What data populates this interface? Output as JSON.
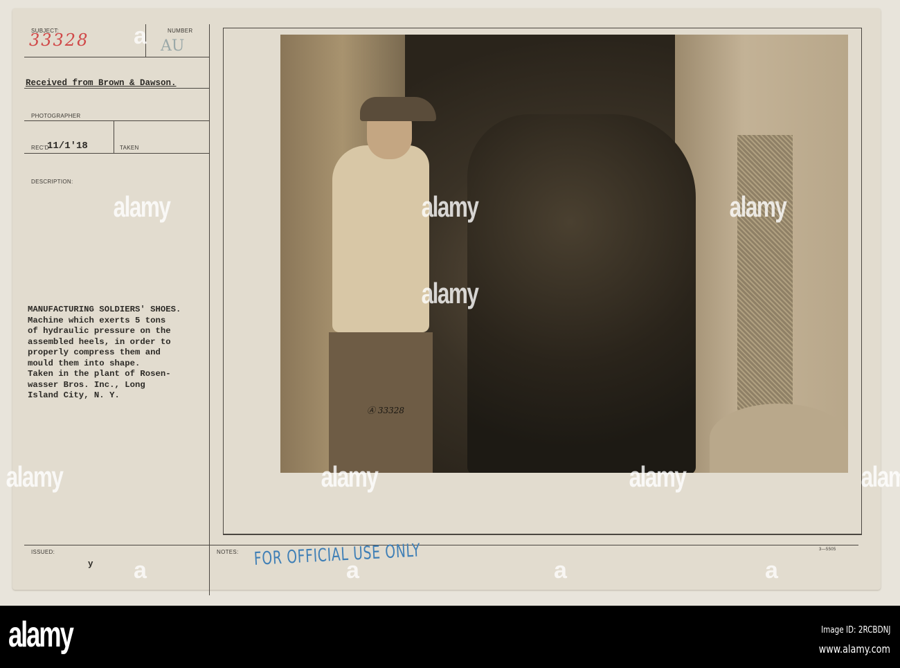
{
  "card": {
    "subject_label": "SUBJECT:",
    "subject_value": "33328",
    "number_label": "NUMBER",
    "number_value": "AU",
    "received_from": "Received from Brown & Dawson.",
    "photographer_label": "PHOTOGRAPHER",
    "recd_label": "REC'D",
    "recd_value": "11/1'18",
    "taken_label": "TAKEN",
    "description_label": "DESCRIPTION:",
    "description": "MANUFACTURING SOLDIERS' SHOES.\nMachine which exerts 5 tons\nof hydraulic pressure on the\nassembled heels, in order to\nproperly compress them and\nmould them into shape.\nTaken in the plant of Rosen-\nwasser Bros. Inc., Long\nIsland City, N. Y.",
    "photo_number": "Ⓐ 33328",
    "issued_label": "ISSUED:",
    "issued_value": "y",
    "notes_label": "NOTES:",
    "stamp": "FOR OFFICIAL USE ONLY",
    "form_number": "3—5505"
  },
  "watermark": {
    "text": "alamy",
    "letter": "a"
  },
  "footer": {
    "logo": "alamy",
    "image_id": "Image ID: 2RCBDNJ",
    "url": "www.alamy.com"
  }
}
